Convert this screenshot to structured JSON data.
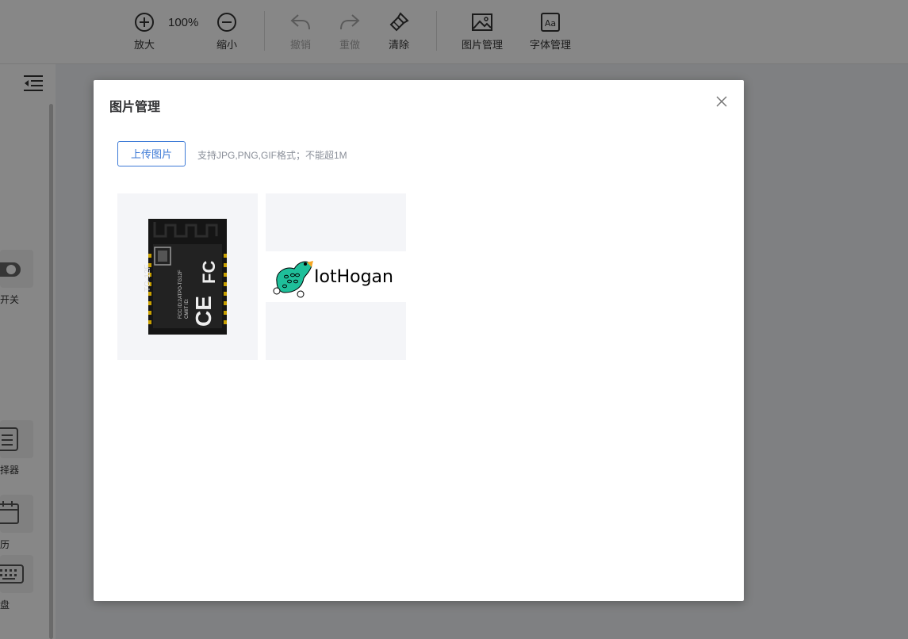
{
  "toolbar": {
    "zoom_in_label": "放大",
    "zoom_value": "100%",
    "zoom_out_label": "缩小",
    "undo_label": "撤销",
    "redo_label": "重做",
    "clear_label": "清除",
    "image_manage_label": "图片管理",
    "font_manage_label": "字体管理"
  },
  "left_panel": {
    "components": [
      {
        "label": "开关",
        "icon": "toggle-switch-icon"
      },
      {
        "label": "选择器",
        "icon": "list-select-icon"
      },
      {
        "label": "日历",
        "icon": "calendar-icon"
      },
      {
        "label": "键盘",
        "icon": "keyboard-icon"
      }
    ]
  },
  "dialog": {
    "title": "图片管理",
    "upload_button": "上传图片",
    "upload_hint": "支持JPG,PNG,GIF格式；不能超1M",
    "images": [
      {
        "name": "tg-12f-module-image",
        "chip_text": [
          "TG-12F",
          "FCC ID:2ATPO-TG12F",
          "CMIIT ID:"
        ],
        "marks": [
          "FC",
          "CE"
        ]
      },
      {
        "name": "iothogan-logo-image",
        "logo_text": "IotHogan"
      }
    ]
  },
  "colors": {
    "accent": "#3d7ad6",
    "overlay": "rgba(0,0,0,0.47)",
    "thumb_bg": "#f4f5f8",
    "parrot": "#1fbf9a",
    "beak": "#f5a623"
  }
}
